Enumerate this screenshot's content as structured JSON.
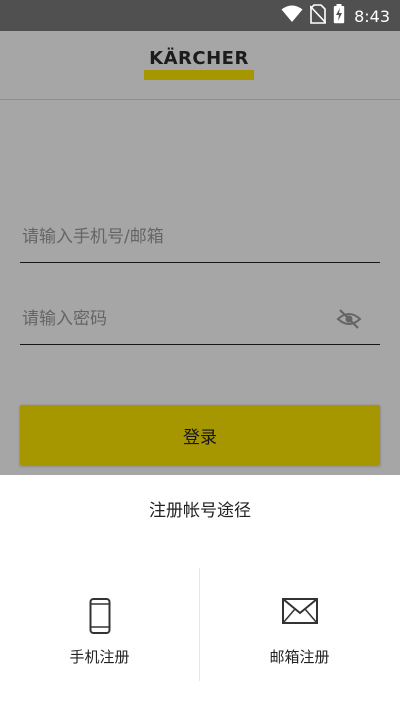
{
  "status_bar": {
    "time": "8:43",
    "icons": [
      "wifi-icon",
      "no-sim-icon",
      "battery-charging-icon"
    ]
  },
  "header": {
    "logo_text": "KÄRCHER",
    "logo_accent_color": "#ffe600"
  },
  "login_form": {
    "phone_email_placeholder": "请输入手机号/邮箱",
    "password_placeholder": "请输入密码",
    "password_toggle_icon": "eye-off-icon",
    "login_label": "登录"
  },
  "register_sheet": {
    "title": "注册帐号途径",
    "options": [
      {
        "label": "手机注册",
        "icon": "smartphone-icon"
      },
      {
        "label": "邮箱注册",
        "icon": "envelope-icon"
      }
    ]
  },
  "colors": {
    "brand_yellow": "#ffe600",
    "status_bar": "#505050",
    "scrim": "rgba(0,0,0,0.35)"
  }
}
